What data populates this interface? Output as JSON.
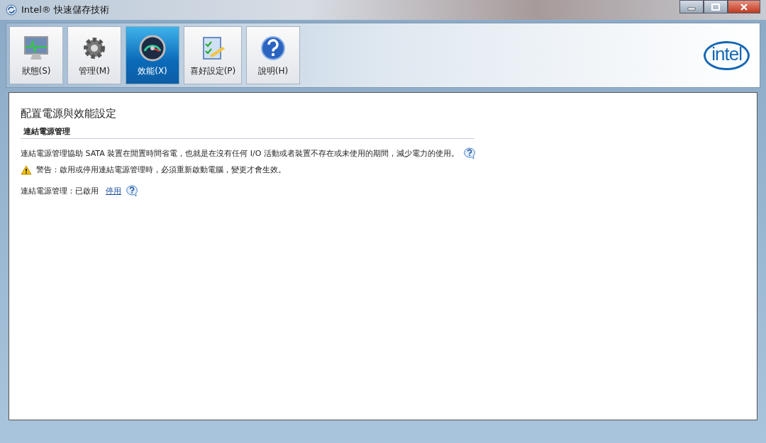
{
  "window": {
    "title": "Intel® 快速儲存技術"
  },
  "tabs": [
    {
      "label": "狀態(S)",
      "selected": false
    },
    {
      "label": "管理(M)",
      "selected": false
    },
    {
      "label": "效能(X)",
      "selected": true
    },
    {
      "label": "喜好設定(P)",
      "selected": false
    },
    {
      "label": "說明(H)",
      "selected": false
    }
  ],
  "logo": "intel",
  "page": {
    "title": "配置電源與效能設定",
    "section": "連結電源管理",
    "description": "連結電源管理協助 SATA 裝置在閒置時間省電，也就是在沒有任何 I/O 活動或者裝置不存在或未使用的期間，減少電力的使用。",
    "warning": "警告：啟用或停用連結電源管理時，必須重新啟動電腦，變更才會生效。",
    "status_label": "連結電源管理：已啟用",
    "action_link": "停用"
  }
}
